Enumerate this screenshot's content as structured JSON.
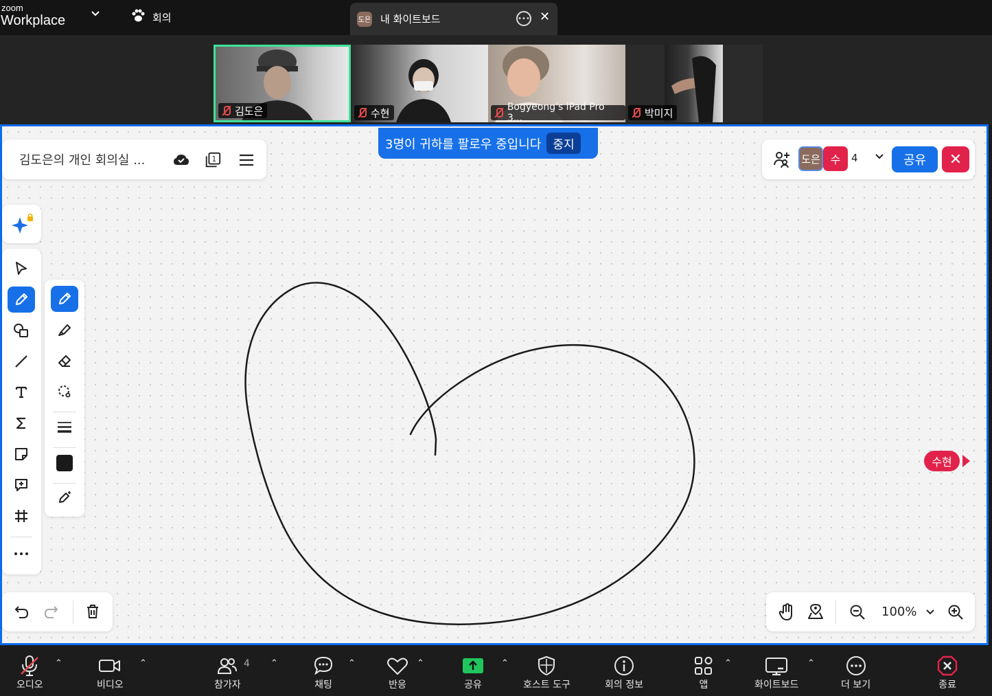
{
  "app": {
    "brand_small": "zoom",
    "brand_name": "Workplace",
    "meeting_tab": "회의",
    "whiteboard_tab": "내 화이트보드",
    "whiteboard_tab_avatar": "도은"
  },
  "participants": [
    {
      "name": "김도은",
      "muted": true,
      "active_speaker": true
    },
    {
      "name": "수현",
      "muted": true
    },
    {
      "name": "Bogyeong's iPad Pro 3...",
      "muted": true
    },
    {
      "name": "박미지",
      "muted": true
    }
  ],
  "whiteboard": {
    "title": "김도은의 개인 회의실 ...",
    "follow_banner": "3명이 귀하를 팔로우 중입니다",
    "stop_label": "중지",
    "collaborators": [
      "도은",
      "수"
    ],
    "collaborator_count": "4",
    "share_label": "공유",
    "zoom_level": "100%",
    "remote_cursor": "수현",
    "active_tool": "pen",
    "pen_color": "#1a1a1a"
  },
  "toolbar": {
    "main_tools": [
      "select",
      "pen",
      "shapes",
      "line",
      "text",
      "formula",
      "sticky-note",
      "comment",
      "frame",
      "more"
    ],
    "pen_tools": [
      "pen",
      "highlighter",
      "eraser",
      "lasso",
      "stroke-width",
      "color",
      "magic-pen"
    ]
  },
  "bottom_bar": [
    {
      "label": "오디오",
      "icon": "mic-off-icon"
    },
    {
      "label": "비디오",
      "icon": "video-icon"
    },
    {
      "label": "참가자",
      "icon": "participants-icon",
      "count": "4"
    },
    {
      "label": "채팅",
      "icon": "chat-icon"
    },
    {
      "label": "반응",
      "icon": "heart-icon"
    },
    {
      "label": "공유",
      "icon": "share-screen-icon"
    },
    {
      "label": "호스트 도구",
      "icon": "shield-icon"
    },
    {
      "label": "회의 정보",
      "icon": "info-icon"
    },
    {
      "label": "앱",
      "icon": "apps-icon"
    },
    {
      "label": "화이트보드",
      "icon": "whiteboard-icon"
    },
    {
      "label": "더 보기",
      "icon": "more-icon"
    },
    {
      "label": "종료",
      "icon": "end-icon"
    }
  ],
  "colors": {
    "accent": "#1770e8",
    "danger": "#e1234b",
    "active_speaker_border": "#3ee29a"
  }
}
